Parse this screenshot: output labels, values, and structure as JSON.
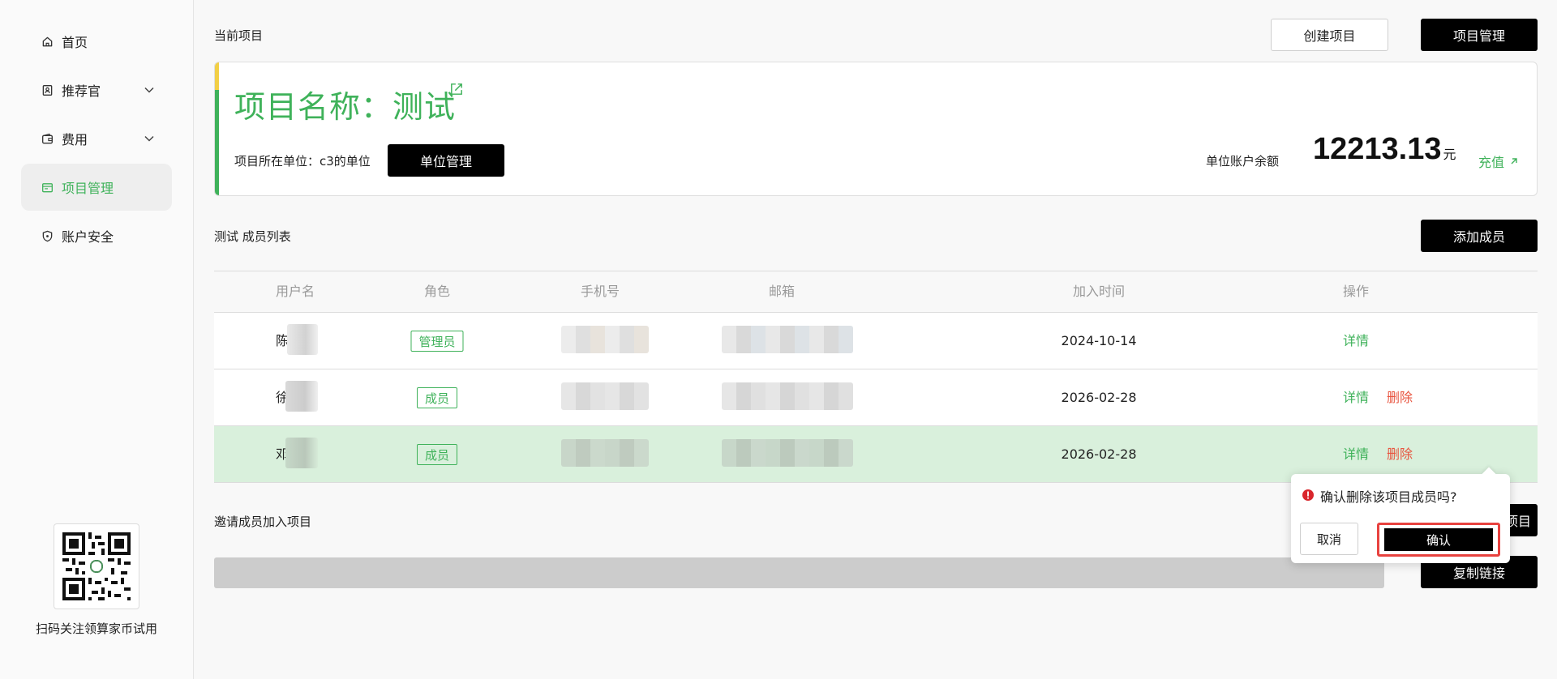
{
  "sidebar": {
    "items": [
      {
        "label": "首页",
        "icon": "home-icon"
      },
      {
        "label": "推荐官",
        "icon": "badge-icon",
        "expandable": true
      },
      {
        "label": "费用",
        "icon": "wallet-icon",
        "expandable": true
      },
      {
        "label": "项目管理",
        "icon": "folder-icon",
        "active": true
      },
      {
        "label": "账户安全",
        "icon": "shield-icon"
      }
    ],
    "qr_caption": "扫码关注领算家币试用"
  },
  "header": {
    "current_project_label": "当前项目",
    "create_project_label": "创建项目",
    "project_manage_label": "项目管理"
  },
  "project": {
    "title": "项目名称：测试",
    "unit_label": "项目所在单位：c3的单位",
    "unit_manage_label": "单位管理",
    "balance_label": "单位账户余额",
    "balance_value": "12213.13",
    "balance_unit": "元",
    "recharge_label": "充值"
  },
  "members": {
    "title": "测试 成员列表",
    "add_label": "添加成员",
    "columns": [
      "用户名",
      "角色",
      "手机号",
      "邮箱",
      "加入时间",
      "操作"
    ],
    "rows": [
      {
        "name": "陈",
        "role": "管理员",
        "joined": "2024-10-14",
        "detail": "详情",
        "highlight": false
      },
      {
        "name": "徐",
        "role": "成员",
        "joined": "2026-02-28",
        "detail": "详情",
        "delete": "删除",
        "highlight": false
      },
      {
        "name": "邓",
        "role": "成员",
        "joined": "2026-02-28",
        "detail": "详情",
        "delete": "删除",
        "highlight": true
      }
    ]
  },
  "invite": {
    "title": "邀请成员加入项目",
    "invite_button_partial": "项目",
    "copy_label": "复制链接"
  },
  "popconfirm": {
    "message": "确认删除该项目成员吗?",
    "cancel_label": "取消",
    "confirm_label": "确认"
  },
  "colors": {
    "accent_green": "#3fb25a",
    "danger_red": "#e8543f",
    "highlight_row": "#d9f0dc",
    "warning_yellow": "#f2cf45"
  }
}
